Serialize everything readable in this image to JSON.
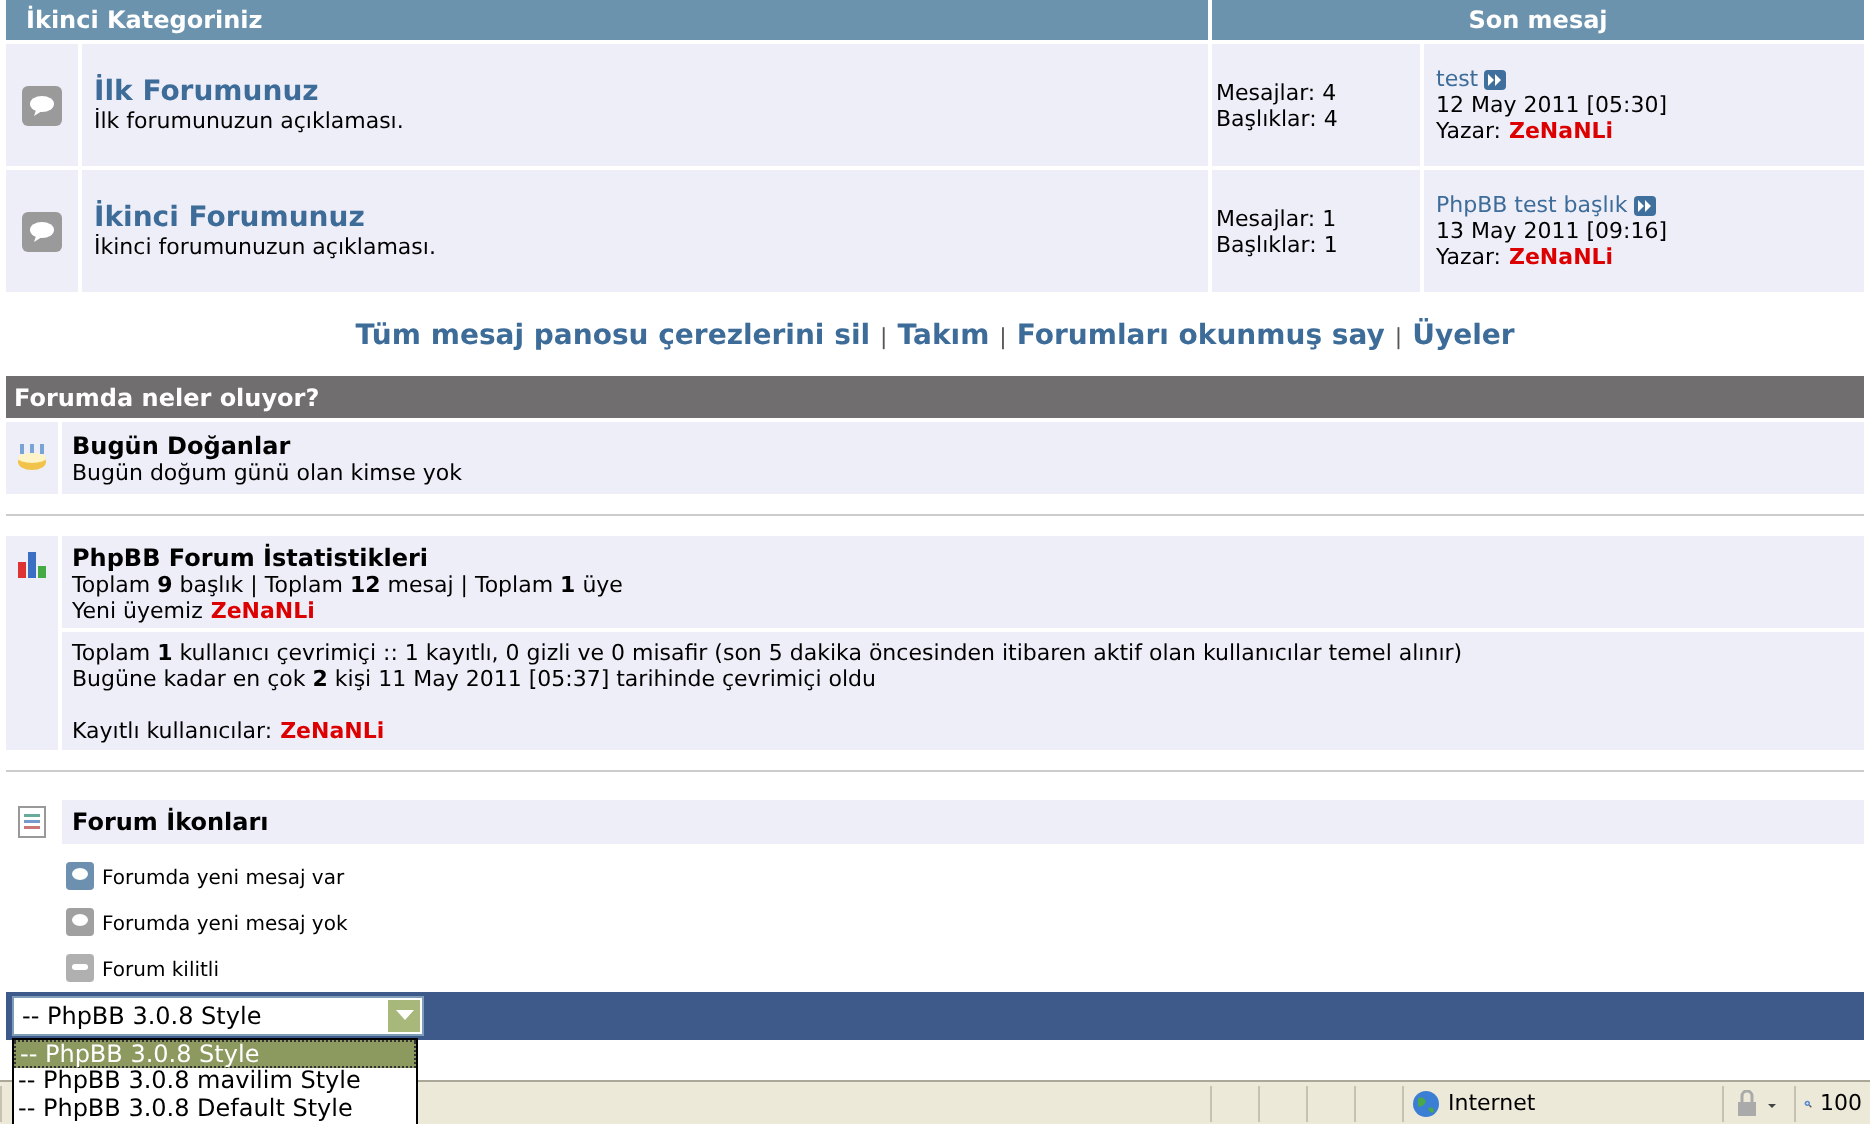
{
  "category": {
    "title": "İkinci Kategoriniz",
    "last_post_heading": "Son mesaj"
  },
  "forums": [
    {
      "title": "İlk Forumunuz",
      "description": "İlk forumunuzun açıklaması.",
      "posts": "Mesajlar: 4",
      "topics": "Başlıklar: 4",
      "last_topic": "test",
      "last_date": "12 May 2011 [05:30]",
      "author_label": "Yazar:",
      "author": "ZeNaNLi"
    },
    {
      "title": "İkinci Forumunuz",
      "description": "İkinci forumunuzun açıklaması.",
      "posts": "Mesajlar: 1",
      "topics": "Başlıklar: 1",
      "last_topic": "PhpBB test başlık",
      "last_date": "13 May 2011 [09:16]",
      "author_label": "Yazar:",
      "author": "ZeNaNLi"
    }
  ],
  "links": [
    "Tüm mesaj panosu çerezlerini sil",
    "Takım",
    "Forumları okunmuş say",
    "Üyeler"
  ],
  "link_separator": "|",
  "whats_on": {
    "title": "Forumda neler oluyor?",
    "birthdays": {
      "title": "Bugün Doğanlar",
      "text": "Bugün doğum günü olan kimse yok"
    },
    "stats": {
      "title": "PhpBB Forum İstatistikleri",
      "totals": "Toplam **9** başlık | Toplam **12** mesaj | Toplam **1** üye",
      "newest_label": "Yeni üyemiz",
      "newest_user": "ZeNaNLi",
      "online": "Toplam **1** kullanıcı çevrimiçi :: 1 kayıtlı, 0 gizli ve 0 misafir (son 5 dakika öncesinden itibaren aktif olan kullanıcılar temel alınır)",
      "record": "Bugüne kadar en çok **2** kişi 11 May 2011 [05:37] tarihinde çevrimiçi oldu",
      "registered_label": "Kayıtlı kullanıcılar:",
      "registered_user": "ZeNaNLi"
    },
    "icons": {
      "title": "Forum İkonları",
      "legend": [
        {
          "kind": "new",
          "label": "Forumda yeni mesaj var"
        },
        {
          "kind": "none",
          "label": "Forumda yeni mesaj yok"
        },
        {
          "kind": "locked",
          "label": "Forum kilitli"
        }
      ]
    }
  },
  "style_select": {
    "value": "-- PhpBB 3.0.8 Style",
    "options": [
      {
        "label": "-- PhpBB 3.0.8 Style",
        "selected": true
      },
      {
        "label": "-- PhpBB 3.0.8 mavilim Style",
        "selected": false
      },
      {
        "label": "-- PhpBB 3.0.8 Default Style",
        "selected": false
      }
    ]
  },
  "status_bar": {
    "zone": "Internet",
    "zoom": "100"
  }
}
